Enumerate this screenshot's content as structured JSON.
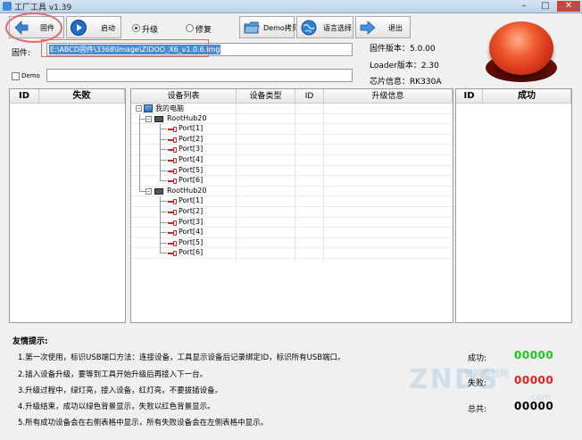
{
  "window": {
    "title": "工厂工具 v1.39",
    "minimize": "–",
    "maximize": "□",
    "close": "✕"
  },
  "toolbar": {
    "firmware_label": "固件",
    "start_label": "启动",
    "upgrade_label": "升级",
    "repair_label": "修复",
    "demo_copy_label": "Demo拷贝",
    "language_label": "语言选择",
    "exit_label": "退出",
    "upgrade_selected": true
  },
  "firmware": {
    "label": "固件:",
    "path": "E:\\ABCD固件\\3368\\Image\\ZIDOO_X6_v1.0.6.img"
  },
  "demo": {
    "label": "Demo",
    "path": ""
  },
  "info": {
    "firmware_version": "固件版本：5.0.00",
    "loader_version": "Loader版本：2.30",
    "chip_info": "芯片信息：RK330A"
  },
  "fail_table": {
    "col_id": "ID",
    "col_fail": "失败"
  },
  "device_table": {
    "col_list": "设备列表",
    "col_type": "设备类型",
    "col_id": "ID",
    "col_upgrade": "升级信息",
    "root": "我的电脑",
    "hubs": [
      {
        "name": "RootHub20",
        "ports": [
          "Port[1]",
          "Port[2]",
          "Port[3]",
          "Port[4]",
          "Port[5]",
          "Port[6]"
        ]
      },
      {
        "name": "RootHub20",
        "ports": [
          "Port[1]",
          "Port[2]",
          "Port[3]",
          "Port[4]",
          "Port[5]",
          "Port[6]"
        ]
      }
    ]
  },
  "success_table": {
    "col_id": "ID",
    "col_success": "成功"
  },
  "tips": {
    "title": "友情提示:",
    "items": [
      "1.第一次使用，标识USB端口方法：连接设备，工具显示设备后记录绑定ID，标识所有USB端口。",
      "2.插入设备升级，要等到工具开始升级后再接入下一台。",
      "3.升级过程中，绿灯亮，接入设备，红灯亮，不要拔插设备。",
      "4.升级结束，成功以绿色背景显示，失败以红色背景显示。",
      "5.所有成功设备会在右侧表格中显示，所有失败设备会在左侧表格中显示。"
    ]
  },
  "stats": {
    "success_label": "成功:",
    "success_value": "00000",
    "fail_label": "失败:",
    "fail_value": "00000",
    "total_label": "总共:",
    "total_value": "00000"
  },
  "watermark": {
    "text": "ZNDS",
    "sub": "智能电视网",
    "url": ".com"
  },
  "colors": {
    "success": "#22c422",
    "fail": "#e02020",
    "total": "#000000",
    "highlight": "#e06a6a"
  }
}
